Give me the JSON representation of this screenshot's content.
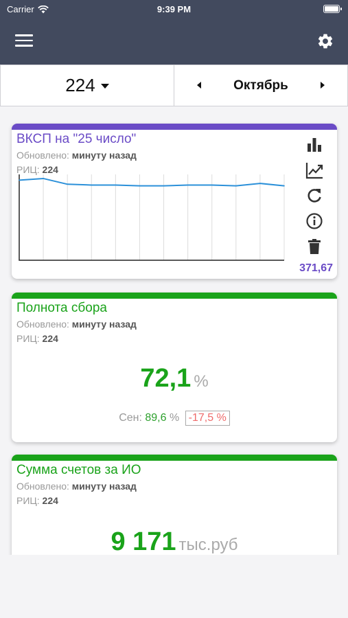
{
  "status_bar": {
    "carrier": "Carrier",
    "time": "9:39 PM"
  },
  "selector": {
    "rits": "224",
    "month": "Октябрь"
  },
  "colors": {
    "nav": "#424a5e",
    "purple": "#6a4bc6",
    "green": "#1aa31a",
    "negative": "#ef6b6b"
  },
  "cards": [
    {
      "title": "ВКСП на \"25 число\"",
      "updated_label": "Обновлено:",
      "updated_value": "минуту назад",
      "rits_label": "РИЦ:",
      "rits_value": "224",
      "value": "371,67",
      "icons": [
        "bar-chart-icon",
        "line-chart-icon",
        "refresh-icon",
        "info-icon",
        "trash-icon"
      ]
    },
    {
      "title": "Полнота сбора",
      "updated_label": "Обновлено:",
      "updated_value": "минуту назад",
      "rits_label": "РИЦ:",
      "rits_value": "224",
      "value": "72,1",
      "unit": "%",
      "compare_label": "Сен:",
      "compare_value": "89,6",
      "compare_unit": "%",
      "delta": "-17,5 %"
    },
    {
      "title": "Сумма счетов за ИО",
      "updated_label": "Обновлено:",
      "updated_value": "минуту назад",
      "rits_label": "РИЦ:",
      "rits_value": "224",
      "value": "9 171",
      "unit": "тыс.руб"
    }
  ],
  "chart_data": {
    "type": "line",
    "x": [
      1,
      2,
      3,
      4,
      5,
      6,
      7,
      8,
      9,
      10,
      11,
      12
    ],
    "series": [
      {
        "values": [
          0.98,
          1.0,
          0.93,
          0.92,
          0.92,
          0.91,
          0.91,
          0.92,
          0.92,
          0.91,
          0.94,
          0.91
        ]
      }
    ],
    "ylim": [
      0,
      1.05
    ],
    "grid": true,
    "color": "#2b90d9"
  }
}
